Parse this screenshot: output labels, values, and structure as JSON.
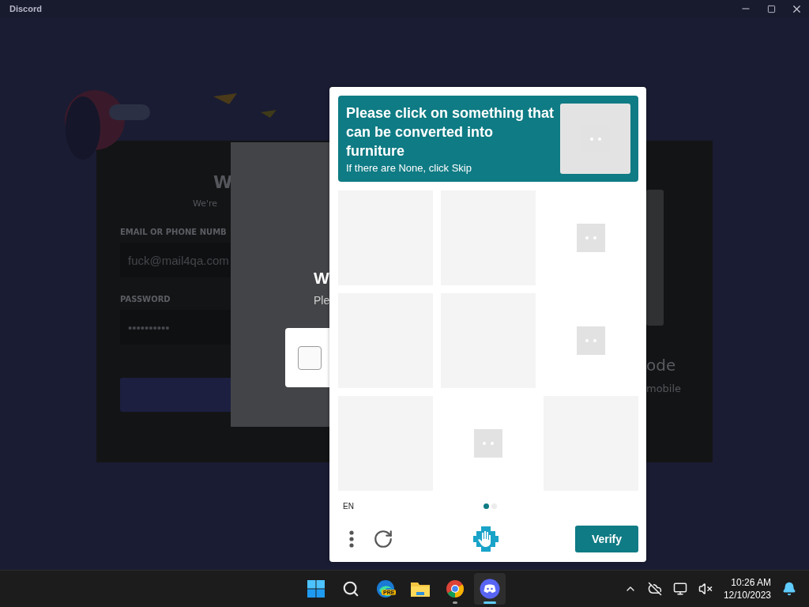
{
  "window": {
    "title": "Discord"
  },
  "login": {
    "heading": "W",
    "subheading": "We're",
    "email_label": "EMAIL OR PHONE NUMB",
    "email_value": "fuck@mail4qa.com",
    "password_label": "PASSWORD",
    "password_value": "••••••••••",
    "qr_heading": "ode",
    "qr_text": "mobile"
  },
  "modal": {
    "heading": "W",
    "text": "Ple",
    "checkbox": {
      "checked": false
    }
  },
  "captcha": {
    "prompt": "Please click on something that can be converted into furniture",
    "hint": "If there are None, click Skip",
    "tiles": [
      {
        "kind": "blank"
      },
      {
        "kind": "blank"
      },
      {
        "kind": "loading"
      },
      {
        "kind": "blank"
      },
      {
        "kind": "blank"
      },
      {
        "kind": "loading"
      },
      {
        "kind": "blank"
      },
      {
        "kind": "loading"
      },
      {
        "kind": "blank"
      }
    ],
    "language": "EN",
    "pages": [
      {
        "selected": true
      },
      {
        "selected": false
      }
    ],
    "verify_button": "Verify"
  },
  "taskbar": {
    "apps": [
      {
        "kind": "start",
        "running": false,
        "selected": false
      },
      {
        "kind": "search",
        "running": false,
        "selected": false
      },
      {
        "kind": "edge",
        "badge": "PRE",
        "running": false,
        "selected": false
      },
      {
        "kind": "files",
        "running": false,
        "selected": false
      },
      {
        "kind": "chrome",
        "running": true,
        "selected": false
      },
      {
        "kind": "discord",
        "running": true,
        "selected": true
      }
    ],
    "time": "10:26 AM",
    "date": "12/10/2023"
  }
}
